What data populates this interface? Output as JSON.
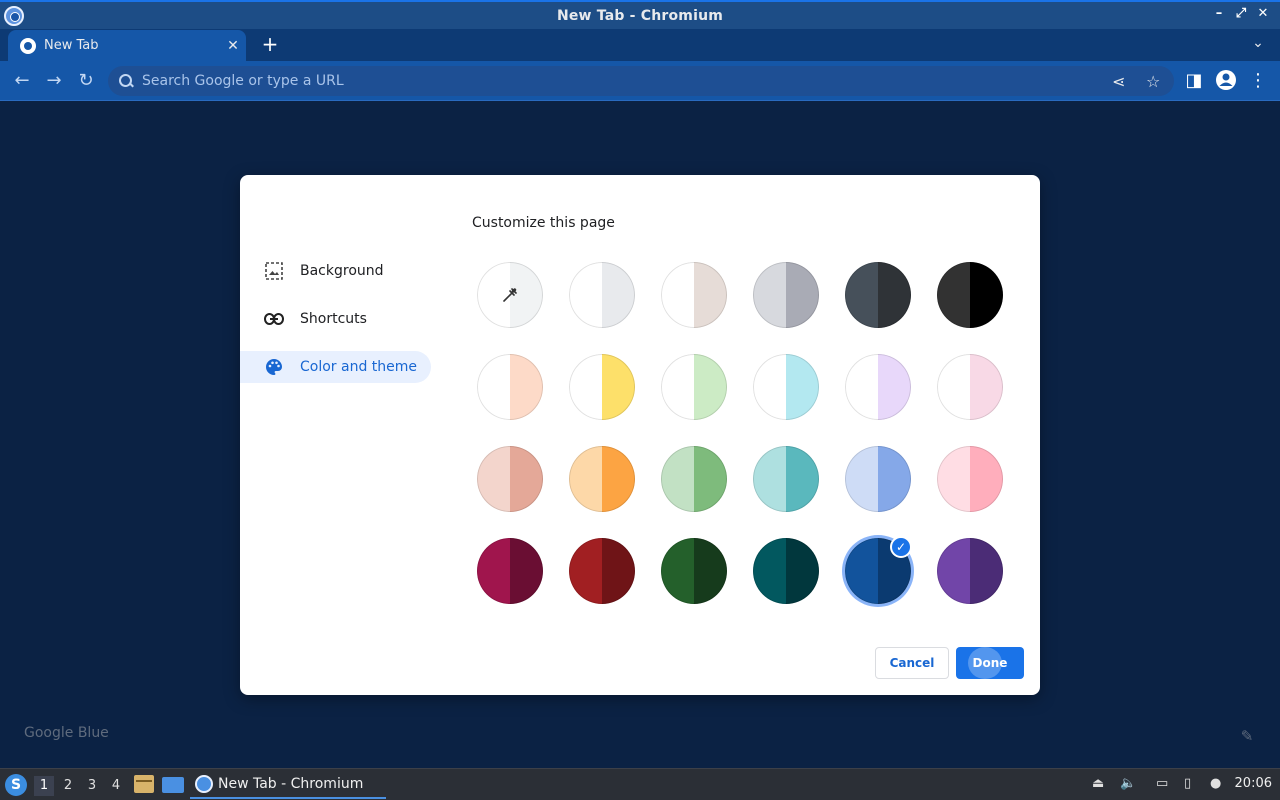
{
  "window": {
    "title": "New Tab - Chromium"
  },
  "tab": {
    "title": "New Tab"
  },
  "omnibox": {
    "placeholder": "Search Google or type a URL"
  },
  "dialog": {
    "title": "Customize this page",
    "nav": [
      {
        "label": "Background",
        "icon": "image-icon"
      },
      {
        "label": "Shortcuts",
        "icon": "link-icon"
      },
      {
        "label": "Color and theme",
        "icon": "palette-icon",
        "active": true
      }
    ],
    "cancel_label": "Cancel",
    "done_label": "Done",
    "swatches": [
      {
        "left": "#ffffff",
        "right": "#f1f3f4",
        "custom": true
      },
      {
        "left": "#ffffff",
        "right": "#e8eaed"
      },
      {
        "left": "#ffffff",
        "right": "#e6dcd7"
      },
      {
        "left": "#d7d9de",
        "right": "#a9abb5"
      },
      {
        "left": "#46505a",
        "right": "#2f3337"
      },
      {
        "left": "#323232",
        "right": "#000000"
      },
      {
        "left": "#ffffff",
        "right": "#fddac8"
      },
      {
        "left": "#ffffff",
        "right": "#fde06a"
      },
      {
        "left": "#ffffff",
        "right": "#ccebc5"
      },
      {
        "left": "#ffffff",
        "right": "#b3e8f0"
      },
      {
        "left": "#ffffff",
        "right": "#e8d8fa"
      },
      {
        "left": "#ffffff",
        "right": "#f8d9e6"
      },
      {
        "left": "#f3d5cc",
        "right": "#e4a898"
      },
      {
        "left": "#fdd8a8",
        "right": "#fca443"
      },
      {
        "left": "#c2e1c4",
        "right": "#7ebb7c"
      },
      {
        "left": "#aee0e0",
        "right": "#5ab8bd"
      },
      {
        "left": "#cedcf6",
        "right": "#85a8e8"
      },
      {
        "left": "#ffdde4",
        "right": "#ffaebc"
      },
      {
        "left": "#a0154d",
        "right": "#6a0e33"
      },
      {
        "left": "#a11f22",
        "right": "#6f1417"
      },
      {
        "left": "#24602b",
        "right": "#163b1c"
      },
      {
        "left": "#02585f",
        "right": "#01373d"
      },
      {
        "left": "#12539c",
        "right": "#0b3a70",
        "selected": true
      },
      {
        "left": "#7145a8",
        "right": "#4b2c76"
      }
    ]
  },
  "theme_name": "Google Blue",
  "taskbar": {
    "workspaces": [
      "1",
      "2",
      "3",
      "4"
    ],
    "window_label": "New Tab - Chromium",
    "clock": "20:06"
  },
  "colors": {
    "background": "#0b2244",
    "toolbar": "#1557a8",
    "accent": "#1a73e8"
  }
}
